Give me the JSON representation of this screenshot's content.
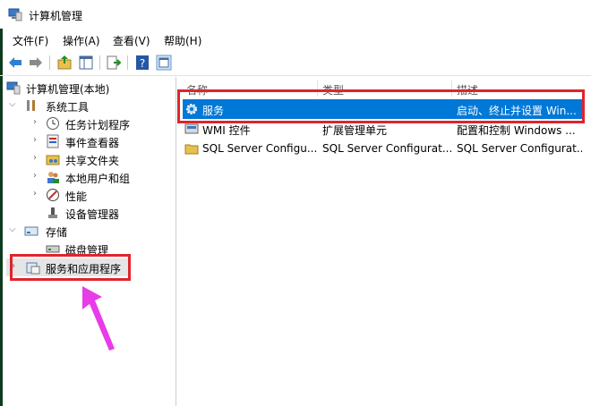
{
  "window": {
    "title": "计算机管理"
  },
  "menu": [
    "文件(F)",
    "操作(A)",
    "查看(V)",
    "帮助(H)"
  ],
  "toolbar": {
    "icons": [
      "back-arrow-icon",
      "forward-arrow-icon",
      "up-folder-icon",
      "show-hide-tree-icon",
      "export-list-icon",
      "help-icon",
      "properties-icon"
    ]
  },
  "tree": {
    "root": "计算机管理(本地)",
    "system_tools": "系统工具",
    "task_scheduler": "任务计划程序",
    "event_viewer": "事件查看器",
    "shared_folders": "共享文件夹",
    "local_users": "本地用户和组",
    "performance": "性能",
    "device_manager": "设备管理器",
    "storage": "存储",
    "disk_management": "磁盘管理",
    "services_apps": "服务和应用程序"
  },
  "list": {
    "columns": [
      "名称",
      "类型",
      "描述"
    ],
    "rows": [
      {
        "name": "服务",
        "type": "",
        "desc": "启动、终止并设置 Win..."
      },
      {
        "name": "WMI 控件",
        "type": "扩展管理单元",
        "desc": "配置和控制 Windows ..."
      },
      {
        "name": "SQL Server Configu...",
        "type": "SQL Server Configurat...",
        "desc": "SQL Server Configurat..."
      }
    ]
  },
  "colors": {
    "selection": "#0078d7",
    "highlight_box": "#e0242c",
    "arrow": "#e83ce8"
  }
}
